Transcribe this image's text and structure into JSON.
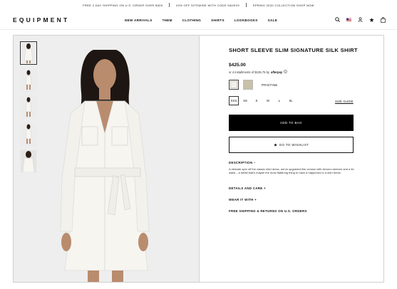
{
  "promo": [
    "FREE 2 DAY SHIPPING ON U.S. ORDER OVER $300",
    "20% OFF SITEWIDE WITH CODE SAVE20",
    "SPRING 2020 COLLECTION SHOP NOW"
  ],
  "header": {
    "logo": "EQUIPMENT",
    "nav": [
      "NEW ARRIVALS",
      "THEM",
      "CLOTHING",
      "SHIRTS",
      "LOOKBOOKS",
      "SALE"
    ]
  },
  "product": {
    "title": "SHORT SLEEVE SLIM SIGNATURE SILK SHIRT",
    "price": "$425.00",
    "installments": "or 4 installments of $106.75 by",
    "afterpay": "afterpay",
    "info_icon": "info-circle-icon",
    "color_name": "PRISTINE",
    "swatch_colors": [
      "#f3f1ea",
      "#c7c1a9"
    ],
    "sizes": [
      "XXS",
      "XS",
      "S",
      "M",
      "L",
      "XL"
    ],
    "selected_size": "XXS",
    "size_guide": "SIZE GUIDE",
    "add_to_bag": "ADD TO BAG",
    "wishlist": "GO TO WISHLIST",
    "description_title": "DESCRIPTION –",
    "description": "A delicate spin off the classic shirt dress, we've upgraded this version with kimono sleeves and a tie waist – a detail that's maybe the most flattering thing to have a happened to a shirt dress.",
    "accordions": [
      "DETAILS AND CARE +",
      "WEAR IT WITH +",
      "FREE SHIPPING & RETURNS ON U.S. ORDERS"
    ]
  },
  "colors": {
    "accent": "#000000",
    "gallery_bg": "#eeeeee"
  }
}
